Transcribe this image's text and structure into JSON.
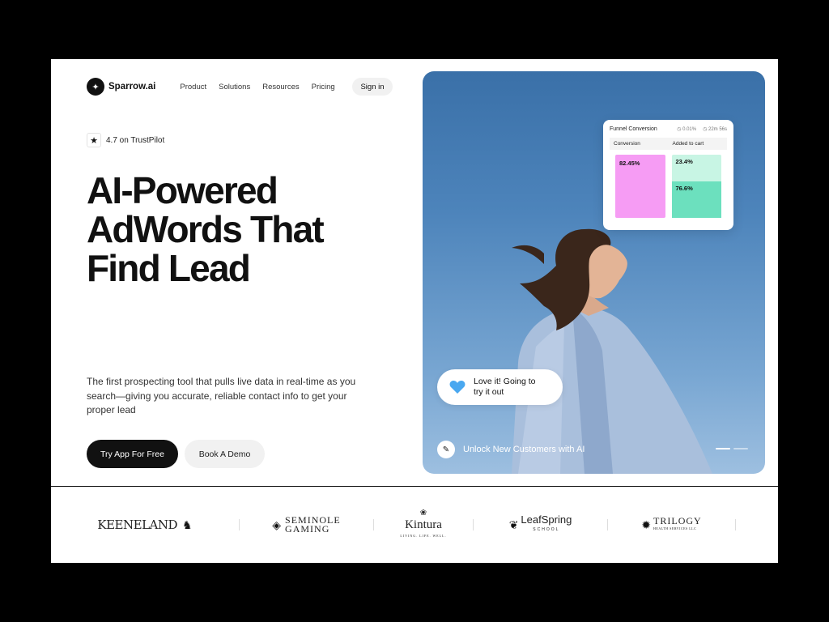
{
  "nav": {
    "brand": "Sparrow.ai",
    "links": [
      "Product",
      "Solutions",
      "Resources",
      "Pricing"
    ],
    "signin": "Sign in"
  },
  "rating": {
    "text": "4.7 on TrustPilot",
    "icon": "star-icon"
  },
  "hero": {
    "headline": [
      "AI-Powered",
      "AdWords That",
      "Find Lead"
    ],
    "description": "The first prospecting tool that pulls live data in real-time as you search—giving you accurate, reliable contact info to get your proper lead",
    "primary_cta": "Try App For Free",
    "secondary_cta": "Book A Demo"
  },
  "funnel": {
    "title": "Funnel Conversion",
    "meta_1": "0.01%",
    "meta_2": "22m 56s",
    "col_1": "Conversion",
    "col_2": "Added to cart",
    "conversion_value": "82.45%",
    "added_top": "23.4%",
    "added_bottom": "76.6%"
  },
  "bubble": {
    "text": "Love it! Going to try it out",
    "icon": "heart-icon"
  },
  "hero_caption": "Unlock New Customers with AI",
  "logos": [
    {
      "name": "KEENELAND"
    },
    {
      "line1": "SEMINOLE",
      "line2": "GAMING"
    },
    {
      "name": "Kintura",
      "tag": "LIVING. LIFE. WELL."
    },
    {
      "name": "LeafSpring",
      "tag": "SCHOOL"
    },
    {
      "name": "TRILOGY",
      "tag": "HEALTH SERVICES LLC"
    }
  ],
  "colors": {
    "accent_pink": "#f69cf4",
    "accent_teal": "#6ce0be",
    "sky": "#4d84bb",
    "heart": "#4aa8f0"
  }
}
